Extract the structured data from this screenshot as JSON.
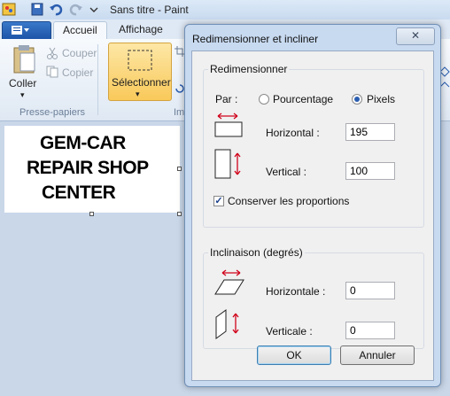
{
  "window": {
    "title": "Sans titre - Paint"
  },
  "ribbon": {
    "tabs": {
      "home": "Accueil",
      "view": "Affichage"
    },
    "clipboard": {
      "paste": "Coller",
      "cut": "Couper",
      "copy": "Copier",
      "group": "Presse-papiers"
    },
    "select": {
      "label": "Sélectionner"
    },
    "image_group_partial": "Im"
  },
  "canvas": {
    "lines": [
      "GEM-CAR",
      "REPAIR SHOP",
      "CENTER"
    ]
  },
  "dialog": {
    "title": "Redimensionner et incliner",
    "close_symbol": "✕",
    "resize": {
      "legend": "Redimensionner",
      "by_label": "Par :",
      "percent_label": "Pourcentage",
      "pixels_label": "Pixels",
      "selected_unit": "pixels",
      "horizontal_label": "Horizontal :",
      "horizontal_value": "195",
      "vertical_label": "Vertical :",
      "vertical_value": "100",
      "keep_ratio_label": "Conserver les proportions",
      "keep_ratio_checked": true
    },
    "skew": {
      "legend": "Inclinaison (degrés)",
      "horizontal_label": "Horizontale :",
      "horizontal_value": "0",
      "vertical_label": "Verticale :",
      "vertical_value": "0"
    },
    "ok_label": "OK",
    "cancel_label": "Annuler"
  },
  "colors": {
    "accent": "#2a5db0",
    "arrow": "#d0021b",
    "select_bg": "#f9c95a"
  }
}
